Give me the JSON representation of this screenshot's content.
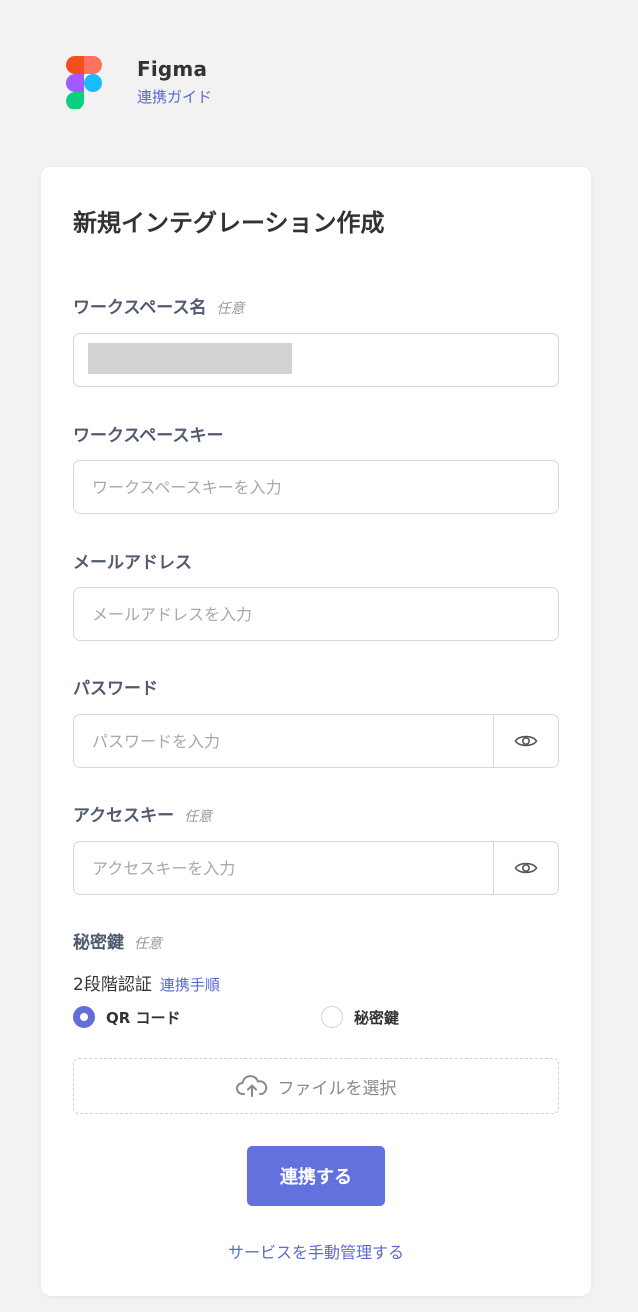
{
  "app": {
    "title": "Figma",
    "guide_link": "連携ガイド"
  },
  "form": {
    "title": "新規インテグレーション作成",
    "optional_tag": "任意",
    "fields": {
      "workspace_name": {
        "label": "ワークスペース名",
        "value": "",
        "placeholder": ""
      },
      "workspace_key": {
        "label": "ワークスペースキー",
        "placeholder": "ワークスペースキーを入力"
      },
      "email": {
        "label": "メールアドレス",
        "placeholder": "メールアドレスを入力"
      },
      "password": {
        "label": "パスワード",
        "placeholder": "パスワードを入力"
      },
      "access_key": {
        "label": "アクセスキー",
        "placeholder": "アクセスキーを入力"
      },
      "secret_key": {
        "label": "秘密鍵"
      }
    },
    "twofa": {
      "label": "2段階認証",
      "link": "連携手順",
      "options": [
        {
          "label": "QR コード",
          "selected": true
        },
        {
          "label": "秘密鍵",
          "selected": false
        }
      ]
    },
    "upload_label": "ファイルを選択",
    "submit_label": "連携する",
    "manual_link": "サービスを手動管理する"
  },
  "icons": {
    "eye": "eye-icon",
    "upload": "cloud-upload-icon"
  },
  "colors": {
    "accent": "#6371df",
    "link": "#5a6acf",
    "background": "#f2f2f2"
  }
}
